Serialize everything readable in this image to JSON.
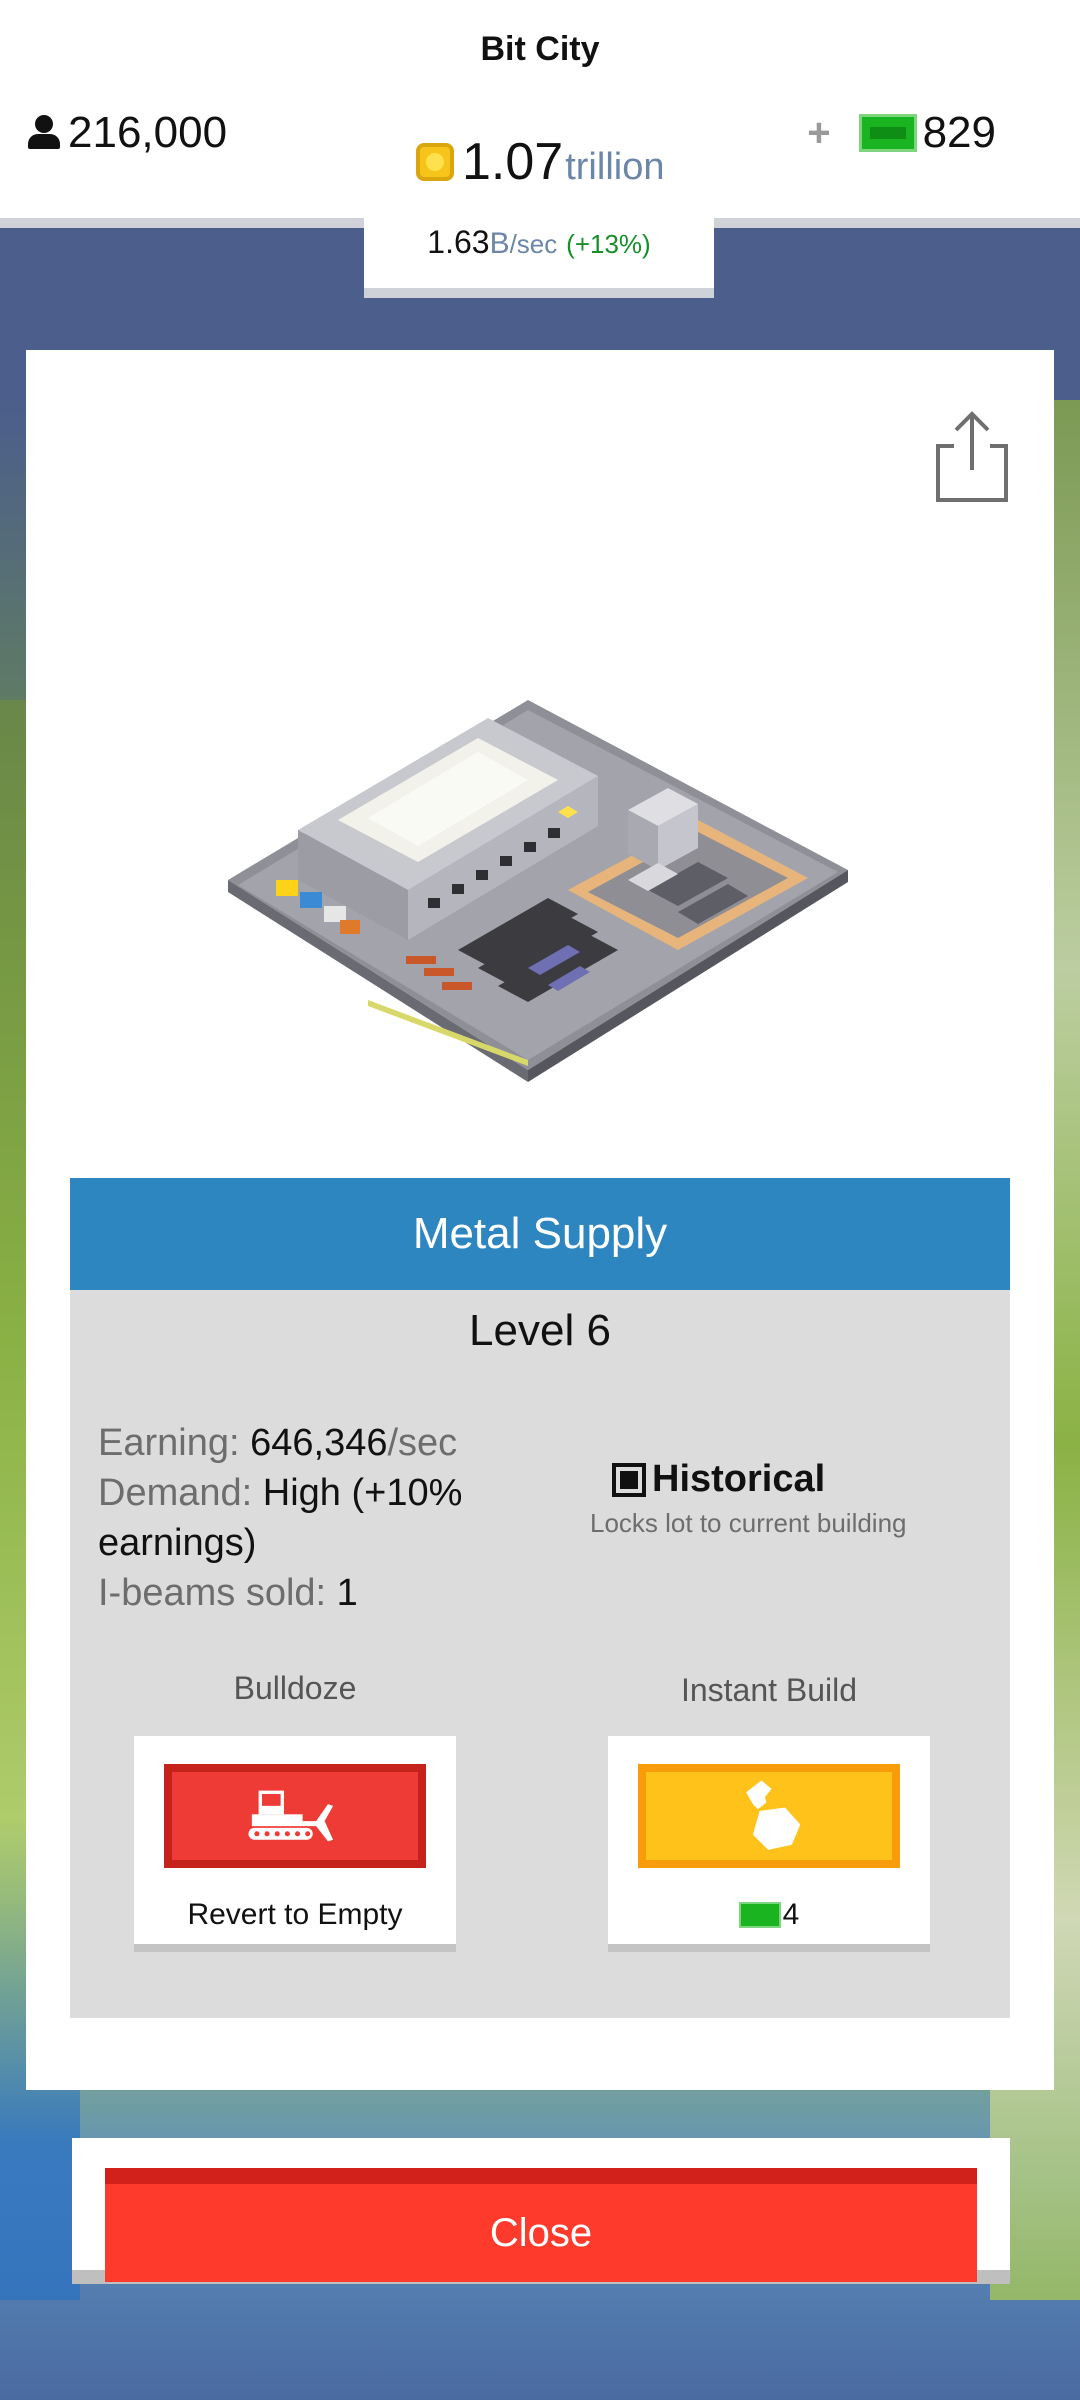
{
  "header": {
    "app_title": "Bit City",
    "population": "216,000",
    "money_value": "1.07",
    "money_unit": "trillion",
    "plus_label": "+",
    "cash": "829",
    "rate_value": "1.63",
    "rate_unit": "B",
    "rate_per": "/sec",
    "rate_change": "(+13%)"
  },
  "building": {
    "name": "Metal Supply",
    "level": "Level 6",
    "earning_label": "Earning:",
    "earning_value": "646,346",
    "earning_unit": "/sec",
    "demand_label": "Demand:",
    "demand_value": "High (+10%",
    "demand_value_2": "earnings)",
    "sold_label": "I-beams sold:",
    "sold_value": "1",
    "historical_label": "Historical",
    "historical_sub": "Locks lot to current building",
    "historical_checked": true
  },
  "actions": {
    "bulldoze_label": "Bulldoze",
    "bulldoze_caption": "Revert to Empty",
    "instant_label": "Instant Build",
    "instant_cost": "4"
  },
  "close_label": "Close",
  "icons": {
    "population": "person-icon",
    "money": "coin-icon",
    "cash": "cash-icon",
    "share": "share-icon",
    "bulldozer": "bulldozer-icon",
    "hammer": "hammer-icon"
  },
  "colors": {
    "header_blue": "#2e86c1",
    "bulldoze_red": "#ef3b35",
    "instant_yellow": "#ffc21a",
    "close_red": "#fe3a2c",
    "cash_green": "#19b41f",
    "coin_gold": "#f7c41b"
  }
}
